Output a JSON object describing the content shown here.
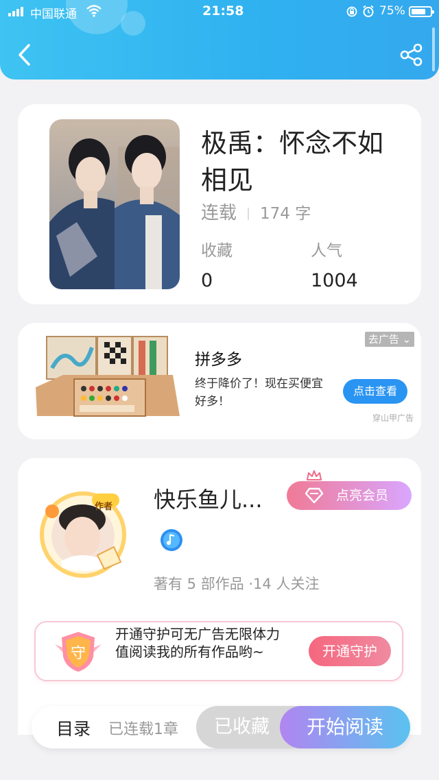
{
  "status_bar": {
    "carrier": "中国联通",
    "time": "21:58",
    "battery": "75%",
    "battery_level": 0.75
  },
  "book": {
    "title": "极禹：怀念不如相见",
    "status": "连载",
    "word_count": "174 字",
    "favorites_label": "收藏",
    "favorites_value": "0",
    "popularity_label": "人气",
    "popularity_value": "1004"
  },
  "ad": {
    "tag": "去广告",
    "title": "拼多多",
    "description": "终于降价了！现在买便宜好多！",
    "button": "点击查看",
    "source": "穿山甲广告"
  },
  "author": {
    "badge": "作者",
    "name": "快乐鱼儿...",
    "vip_button": "点亮会员",
    "stats": "著有 5 部作品 ·14 人关注"
  },
  "guard": {
    "icon_char": "守",
    "text": "开通守护可无广告无限体力值阅读我的所有作品哟~",
    "button": "开通守护"
  },
  "bottom_bar": {
    "toc": "目录",
    "chapters": "已连载1章",
    "favorited": "已收藏",
    "start_reading": "开始阅读"
  },
  "colors": {
    "header": "#2fb1f0",
    "accent_blue": "#2a94f2",
    "vip_pink": "#f07a96",
    "guard_pink": "#f5677e"
  }
}
